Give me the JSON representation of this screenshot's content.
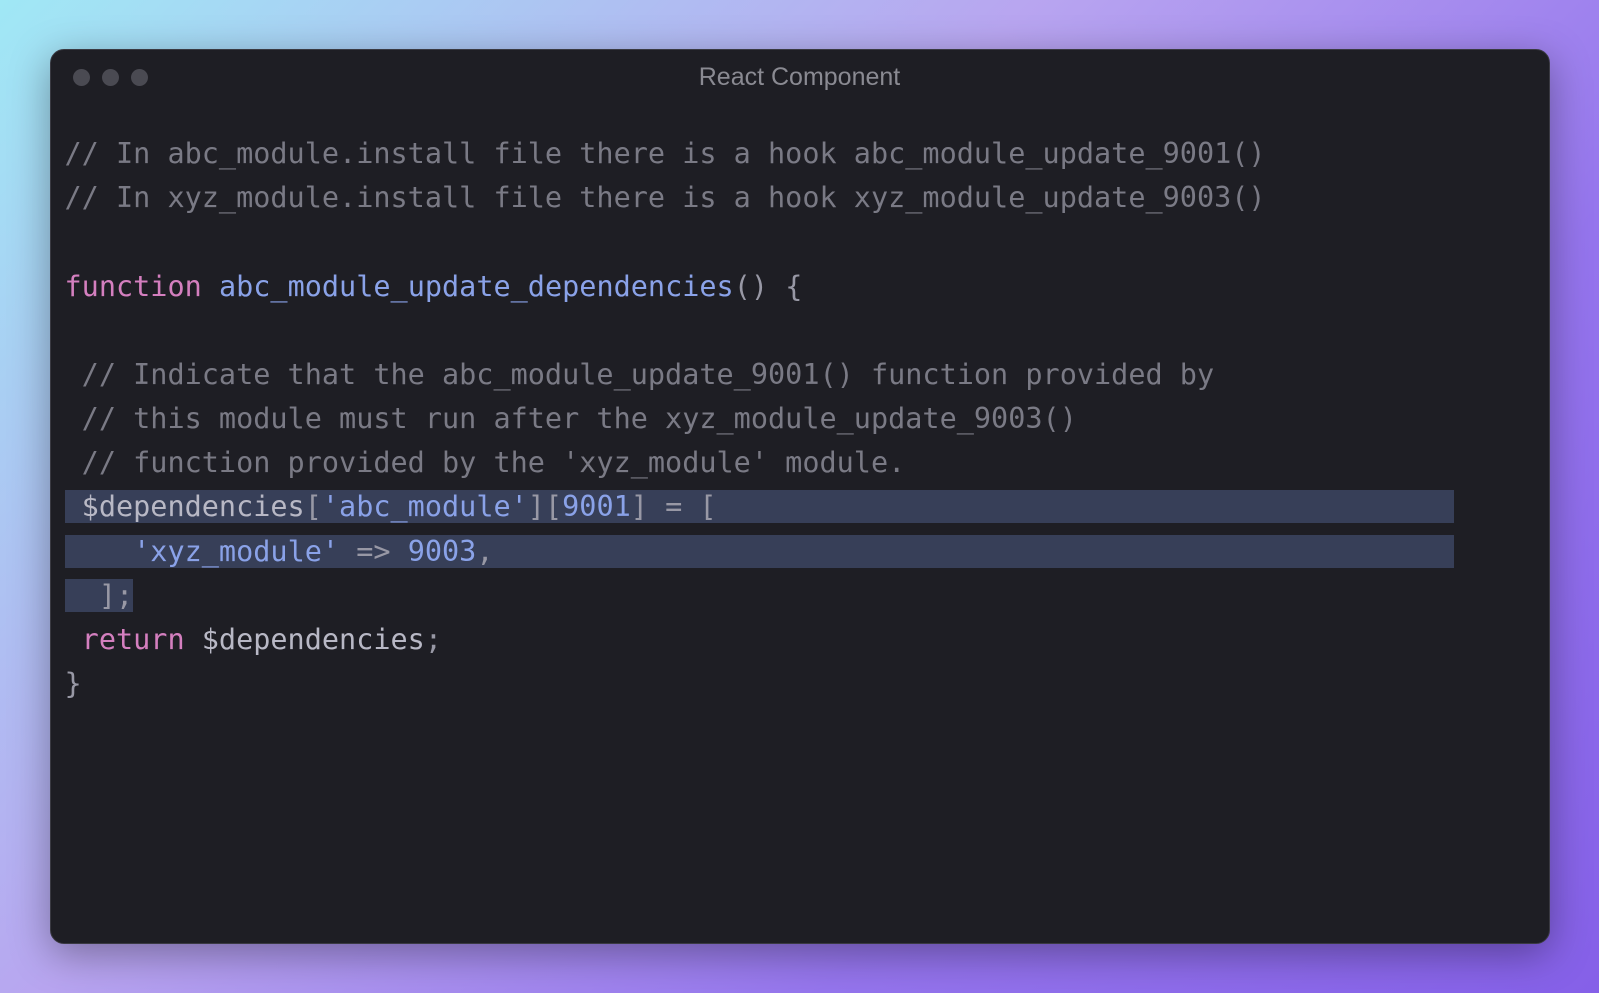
{
  "window": {
    "title": "React Component"
  },
  "code": {
    "c1": "// In abc_module.install file there is a hook abc_module_update_9001()",
    "c2": "// In xyz_module.install file there is a hook xyz_module_update_9003()",
    "kw_function": "function",
    "fn_name": "abc_module_update_dependencies",
    "paren_open": "()",
    "brace_open": " {",
    "c3": " // Indicate that the abc_module_update_9001() function provided by",
    "c4": " // this module must run after the xyz_module_update_9003()",
    "c5": " // function provided by the 'xyz_module' module.",
    "var_deps": " $dependencies",
    "bracket1_open": "[",
    "str_abc": "'abc_module'",
    "bracket1_close": "]",
    "bracket2_open": "[",
    "num_9001": "9001",
    "bracket2_close": "]",
    "assign": " = [",
    "indent_item": "    ",
    "str_xyz": "'xyz_module'",
    "arrow": " => ",
    "num_9003": "9003",
    "comma": ",",
    "close_arr": "  ];",
    "kw_return": " return",
    "var_deps2": " $dependencies",
    "semicolon": ";",
    "brace_close": "}"
  }
}
